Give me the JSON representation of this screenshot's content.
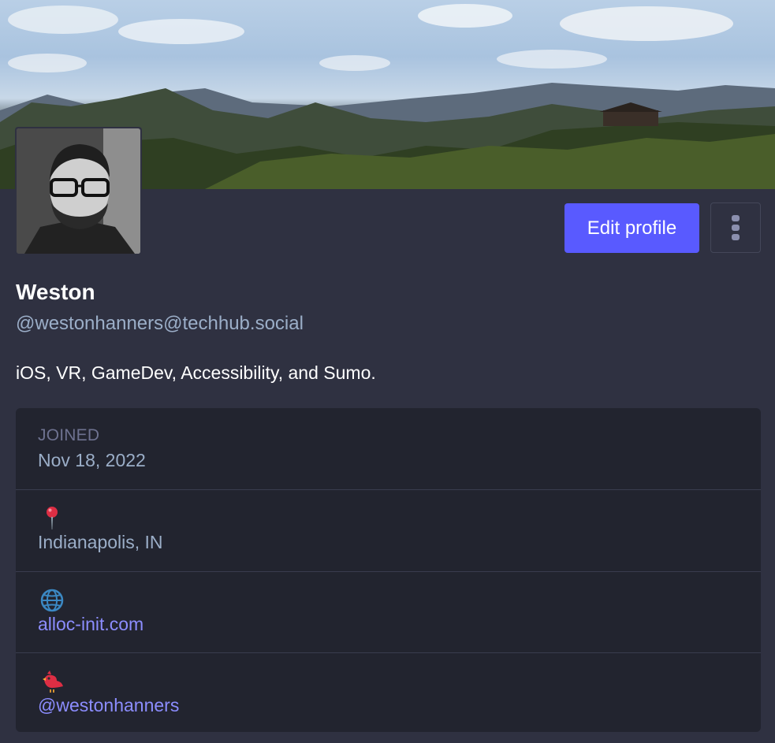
{
  "profile": {
    "display_name": "Weston",
    "handle": "@westonhanners@techhub.social",
    "bio": "iOS, VR, GameDev, Accessibility, and Sumo."
  },
  "actions": {
    "edit_profile_label": "Edit profile",
    "more_icon": "vertical-ellipsis-icon"
  },
  "fields": {
    "joined": {
      "label": "JOINED",
      "value": "Nov 18, 2022"
    },
    "location": {
      "icon": "pushpin-icon",
      "value": "Indianapolis, IN"
    },
    "website": {
      "icon": "globe-icon",
      "value": "alloc-init.com"
    },
    "twitter": {
      "icon": "bird-icon",
      "value": "@westonhanners"
    }
  },
  "colors": {
    "background": "#2f3141",
    "card": "#22242f",
    "accent": "#595aff",
    "link": "#8c8dff",
    "muted_text": "#9baec8"
  }
}
